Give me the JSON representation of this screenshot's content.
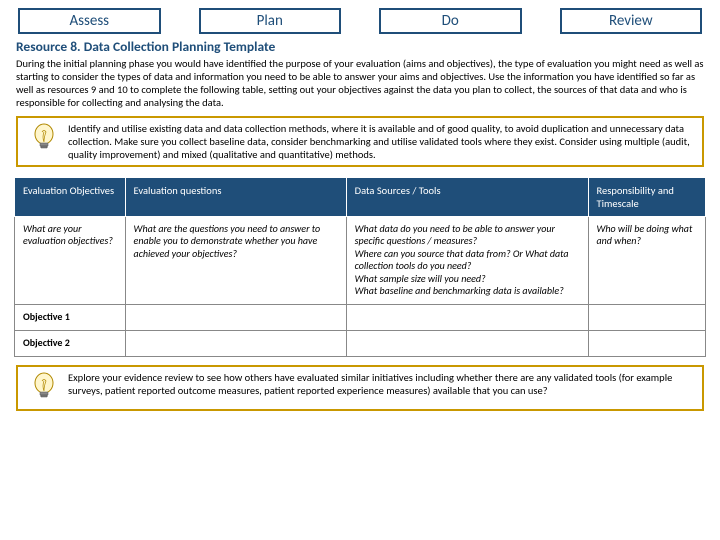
{
  "phases": [
    "Assess",
    "Plan",
    "Do",
    "Review"
  ],
  "title": "Resource 8. Data Collection Planning Template",
  "intro": "During the initial planning phase you would have identified the purpose of your evaluation (aims and objectives), the type of evaluation you might need as well as starting to consider the types of data and information you need to be able to answer your aims and objectives. Use the information you have identified so far as well as resources 9 and 10 to complete the following table, setting out your objectives against the data you plan to collect, the sources of that data and who is responsible for collecting and analysing the data.",
  "callout1": "Identify and utilise existing data and data collection methods, where it is available and of good quality, to avoid duplication and unnecessary data collection. Make sure you collect baseline data, consider benchmarking and utilise validated tools where they exist.  Consider using multiple (audit, quality improvement) and mixed (qualitative and quantitative) methods.",
  "table": {
    "headers": [
      "Evaluation Objectives",
      "Evaluation questions",
      "Data Sources / Tools",
      "Responsibility and Timescale"
    ],
    "guidance": {
      "c1": "What are your evaluation objectives?",
      "c2": "What are the questions you need to answer to enable you to demonstrate whether you have achieved your objectives?",
      "c3": "What data do you need to be able to answer your specific questions / measures?\nWhere can you source that data from?  Or What data collection tools do you need?\nWhat sample size will you need?\nWhat baseline and benchmarking data is available?",
      "c4": "Who will be doing what and when?"
    },
    "rows": [
      "Objective 1",
      "Objective 2"
    ]
  },
  "callout2": "Explore your evidence review to see how others have evaluated similar initiatives including whether there are any validated tools (for example surveys, patient reported outcome measures, patient  reported experience measures) available that you can use?"
}
